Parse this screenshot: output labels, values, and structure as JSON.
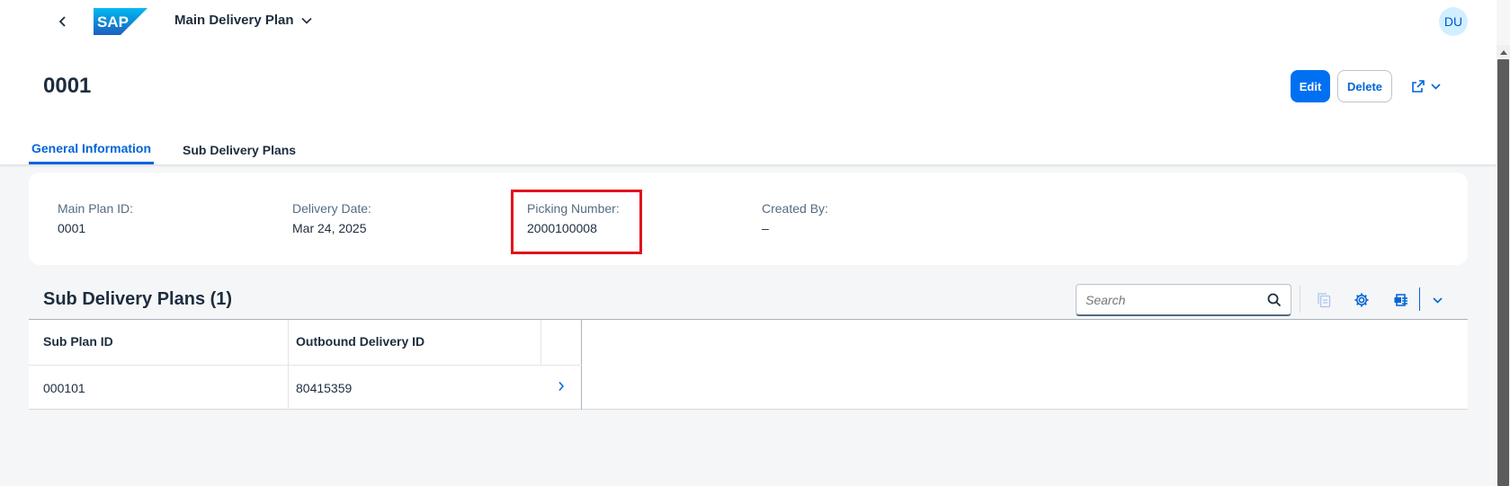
{
  "shell": {
    "title": "Main Delivery Plan",
    "logo_text": "SAP",
    "avatar_initials": "DU"
  },
  "header": {
    "object_title": "0001",
    "edit_label": "Edit",
    "delete_label": "Delete"
  },
  "tabs": [
    {
      "label": "General Information",
      "active": true
    },
    {
      "label": "Sub Delivery Plans",
      "active": false
    }
  ],
  "general_info": {
    "fields": [
      {
        "label": "Main Plan ID:",
        "value": "0001"
      },
      {
        "label": "Delivery Date:",
        "value": "Mar 24, 2025"
      },
      {
        "label": "Picking Number:",
        "value": "2000100008"
      },
      {
        "label": "Created By:",
        "value": "–"
      }
    ]
  },
  "sub_plans": {
    "title": "Sub Delivery Plans (1)",
    "search_placeholder": "Search",
    "columns": [
      "Sub Plan ID",
      "Outbound Delivery ID"
    ],
    "rows": [
      {
        "sub_plan_id": "000101",
        "outbound_delivery_id": "80415359"
      }
    ]
  },
  "colors": {
    "accent": "#0070f2",
    "highlight_box": "#e0141e",
    "page_bg": "#f5f6f7"
  },
  "icons": [
    "back-icon",
    "chevron-down-icon",
    "share-icon",
    "search-icon",
    "copy-icon",
    "settings-gear-icon",
    "export-icon",
    "chevron-right-icon"
  ]
}
